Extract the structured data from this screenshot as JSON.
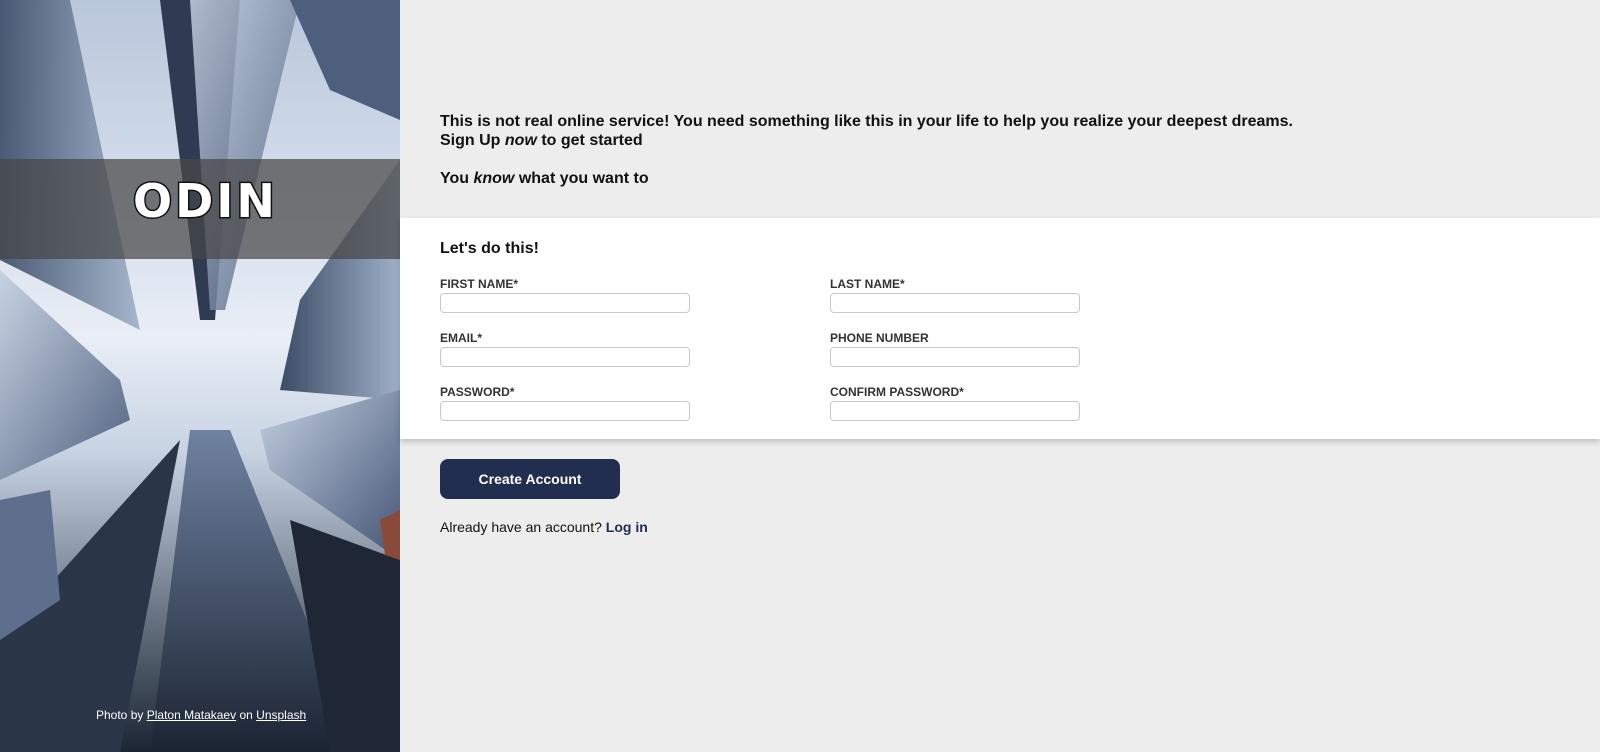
{
  "hero": {
    "logo": "ODIN",
    "credit_prefix": "Photo by",
    "credit_author": "Platon Matakaev",
    "credit_mid": "on",
    "credit_source": "Unsplash"
  },
  "intro": {
    "line1": "This is not real online service! You need something like this in your life to help you realize your deepest dreams.",
    "line2_before": "Sign Up ",
    "line2_em": "now",
    "line2_after": " to get started",
    "line3_before": "You ",
    "line3_em": "know",
    "line3_after": " what you want to"
  },
  "form": {
    "title": "Let's do this!",
    "first_name_label": "First Name*",
    "last_name_label": "Last Name*",
    "email_label": "Email*",
    "phone_label": "Phone Number",
    "password_label": "Password*",
    "confirm_password_label": "Confirm Password*",
    "first_name_value": "",
    "last_name_value": "",
    "email_value": "",
    "phone_value": "",
    "password_value": "",
    "confirm_password_value": ""
  },
  "actions": {
    "submit_label": "Create Account",
    "login_prompt": "Already have an account?",
    "login_link": "Log in"
  },
  "colors": {
    "accent": "#222e50",
    "background": "#ededed",
    "card": "#ffffff"
  }
}
